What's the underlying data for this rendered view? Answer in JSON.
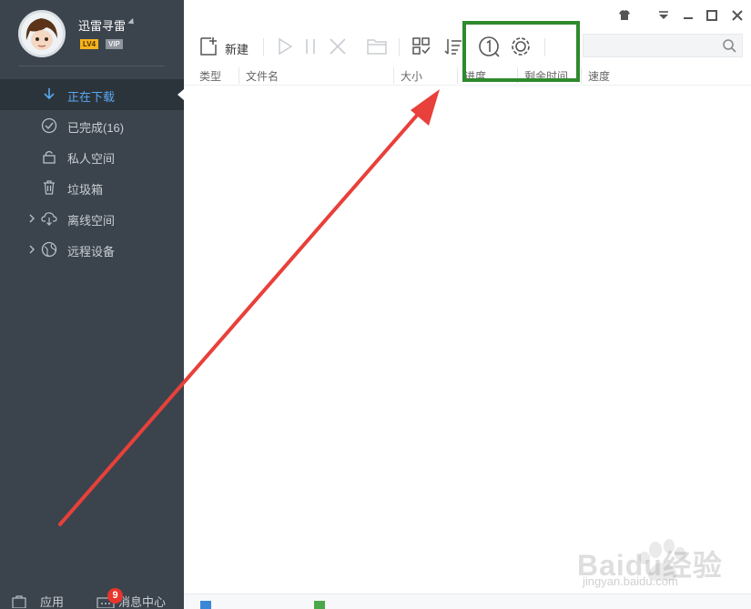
{
  "user": {
    "name": "迅雷寻雷",
    "level": "LV4",
    "vip": "VIP"
  },
  "sidebar": {
    "items": [
      {
        "label": "正在下载",
        "icon": "download-icon",
        "active": true
      },
      {
        "label": "已完成(16)",
        "icon": "check-circle-icon"
      },
      {
        "label": "私人空间",
        "icon": "lock-icon"
      },
      {
        "label": "垃圾箱",
        "icon": "trash-icon"
      },
      {
        "label": "离线空间",
        "icon": "cloud-download-icon"
      },
      {
        "label": "远程设备",
        "icon": "remote-device-icon"
      }
    ],
    "bottom": {
      "apps_label": "应用",
      "messages_label": "消息中心",
      "messages_count": "9"
    }
  },
  "toolbar": {
    "new_label": "新建"
  },
  "columns": {
    "type": "类型",
    "filename": "文件名",
    "size": "大小",
    "progress": "进度",
    "remaining": "剩余时间",
    "speed": "速度"
  },
  "watermark": {
    "brand": "Baidu经验",
    "url": "jingyan.baidu.com"
  },
  "colors": {
    "sidebar_bg": "#3b444d",
    "accent": "#58a8f0",
    "highlight_border": "#2f8a2d",
    "arrow": "#e8403a"
  }
}
